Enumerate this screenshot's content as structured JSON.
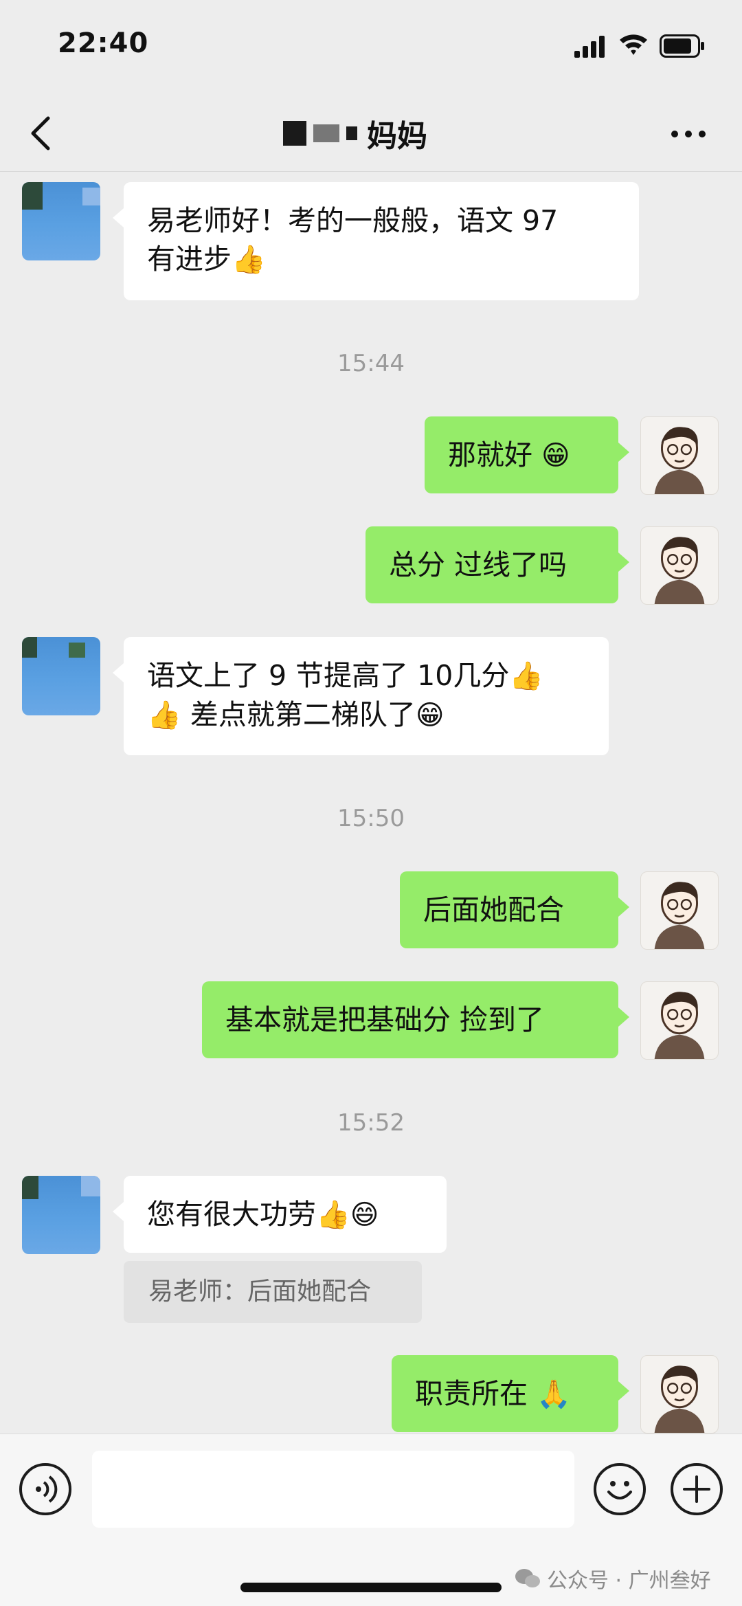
{
  "status_bar": {
    "time": "22:40"
  },
  "header": {
    "contact_name": "妈妈"
  },
  "messages": [
    {
      "side": "left",
      "line1": "易老师好！考的一般般，语文 97",
      "line2": "有进步",
      "emoji": "👍"
    },
    {
      "type": "time",
      "text": "15:44"
    },
    {
      "side": "right",
      "text": "那就好 ",
      "emoji": "😁"
    },
    {
      "side": "right",
      "text": "总分 过线了吗"
    },
    {
      "side": "left",
      "line1": "语文上了 9 节提高了 10几分",
      "line1_emoji": "👍",
      "line2_emoji": "👍",
      "line2": " 差点就第二梯队了",
      "line2_tail_emoji": "😁"
    },
    {
      "type": "time",
      "text": "15:50"
    },
    {
      "side": "right",
      "text": "后面她配合"
    },
    {
      "side": "right",
      "text": "基本就是把基础分 捡到了"
    },
    {
      "type": "time",
      "text": "15:52"
    },
    {
      "side": "left",
      "text": "您有很大功劳",
      "emoji": "👍😄"
    },
    {
      "type": "quote",
      "text": "易老师：后面她配合"
    },
    {
      "side": "right",
      "text": "职责所在 ",
      "emoji": "🙏"
    }
  ],
  "input_bar": {
    "placeholder": ""
  },
  "watermark": {
    "text": "公众号 · 广州叁好"
  },
  "colors": {
    "sent_bubble": "#95ec69",
    "received_bubble": "#ffffff",
    "background": "#ededed"
  }
}
